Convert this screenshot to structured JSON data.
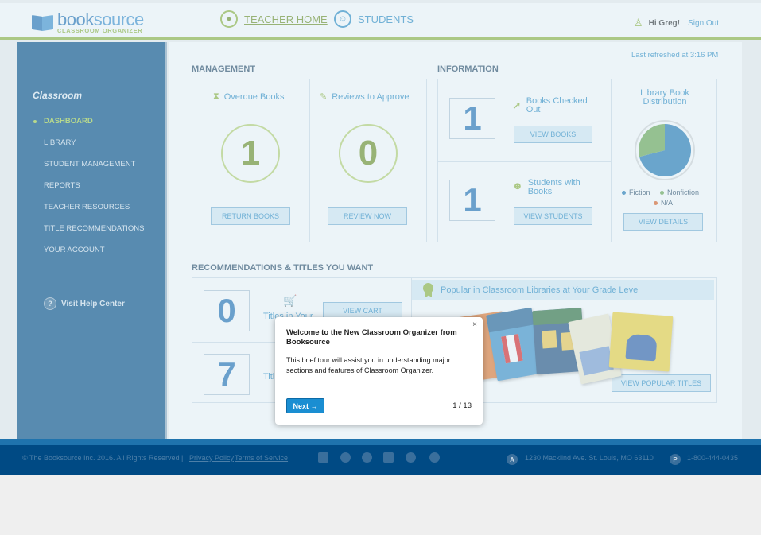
{
  "header": {
    "brand_name_a": "book",
    "brand_name_b": "source",
    "brand_sub": "CLASSROOM ORGANIZER",
    "nav": [
      {
        "label": "TEACHER HOME"
      },
      {
        "label": "STUDENTS"
      }
    ],
    "greeting": "Hi Greg!",
    "sign_out": "Sign Out"
  },
  "sidebar": {
    "title": "Classroom",
    "items": [
      {
        "label": "DASHBOARD",
        "active": true
      },
      {
        "label": "LIBRARY"
      },
      {
        "label": "STUDENT MANAGEMENT"
      },
      {
        "label": "REPORTS"
      },
      {
        "label": "TEACHER RESOURCES"
      },
      {
        "label": "TITLE RECOMMENDATIONS"
      },
      {
        "label": "YOUR ACCOUNT"
      }
    ],
    "help_label": "Visit Help Center"
  },
  "main": {
    "last_refreshed": "Last refreshed at 3:16 PM",
    "management": {
      "title": "MANAGEMENT",
      "overdue": {
        "label": "Overdue Books",
        "count": "1",
        "button": "RETURN BOOKS"
      },
      "reviews": {
        "label": "Reviews to Approve",
        "count": "0",
        "button": "REVIEW NOW"
      }
    },
    "information": {
      "title": "INFORMATION",
      "checked_out": {
        "count": "1",
        "label_line1": "Books Checked",
        "label_line2": "Out",
        "button": "VIEW BOOKS"
      },
      "students_with_books": {
        "count": "1",
        "label_line1": "Students with",
        "label_line2": "Books",
        "button": "VIEW STUDENTS"
      },
      "distribution": {
        "title_line1": "Library Book",
        "title_line2": "Distribution",
        "legend": [
          "Fiction",
          "Nonfiction",
          "N/A"
        ],
        "button": "VIEW DETAILS",
        "colors": {
          "fiction": "#1f78b4",
          "nonfiction": "#6aa84f",
          "na": "#e06020"
        }
      }
    },
    "recommendations": {
      "title": "RECOMMENDATIONS & TITLES YOU WANT",
      "cart": {
        "count": "0",
        "label": "Titles in Your",
        "button": "VIEW CART"
      },
      "wanted": {
        "count": "7",
        "label": "Titl"
      },
      "popular_title": "Popular in Classroom Libraries at Your Grade Level",
      "popular_button": "VIEW POPULAR TITLES"
    }
  },
  "chart_data": {
    "type": "pie",
    "title": "Library Book Distribution",
    "categories": [
      "Fiction",
      "Nonfiction",
      "N/A"
    ],
    "values": [
      0.71,
      0.29,
      0.0
    ]
  },
  "footer": {
    "copyright": "© The Booksource Inc. 2016. All Rights Reserved",
    "sep": "|",
    "privacy": "Privacy Policy",
    "terms": "Terms of Service",
    "address_badge": "A",
    "address": "1230 Macklind Ave. St. Louis, MO 63110",
    "phone_badge": "P",
    "phone": "1-800-444-0435"
  },
  "tour": {
    "close": "×",
    "title": "Welcome to the New Classroom Organizer from Booksource",
    "body": "This brief tour will assist you in understanding major sections and features of Classroom Organizer.",
    "next": "Next →",
    "step": "1 / 13"
  }
}
